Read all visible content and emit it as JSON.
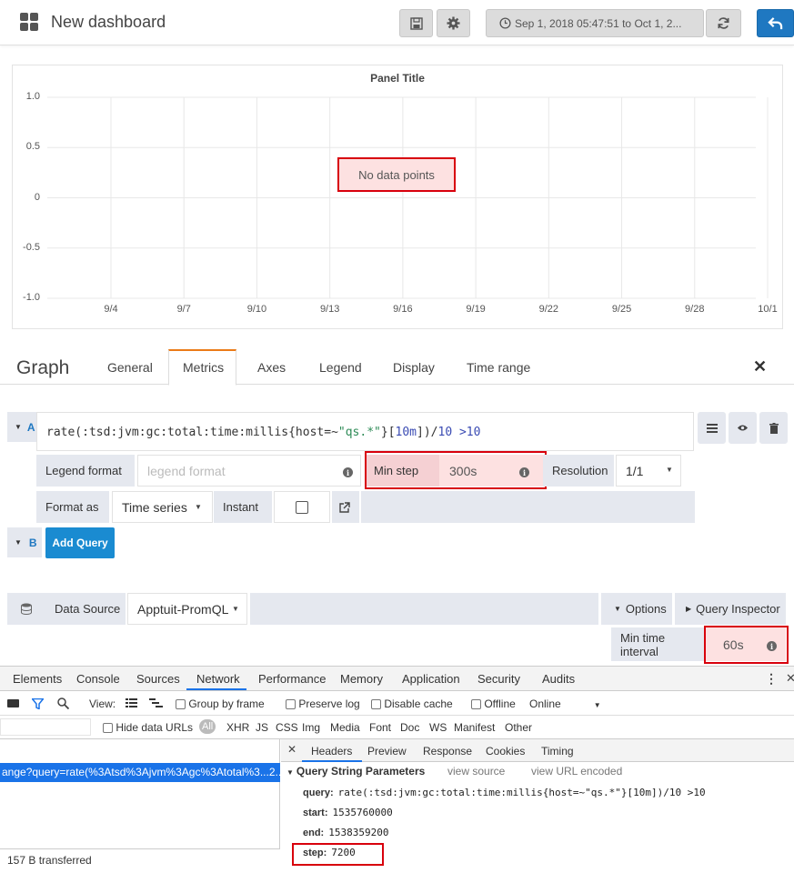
{
  "header": {
    "title": "New dashboard",
    "time_range": "Sep 1, 2018 05:47:51 to Oct 1, 2..."
  },
  "panel": {
    "title": "Panel Title",
    "no_data": "No data points",
    "y_ticks": [
      "1.0",
      "0.5",
      "0",
      "-0.5",
      "-1.0"
    ],
    "x_ticks": [
      "9/4",
      "9/7",
      "9/10",
      "9/13",
      "9/16",
      "9/19",
      "9/22",
      "9/25",
      "9/28",
      "10/1"
    ]
  },
  "editor": {
    "title": "Graph",
    "tabs": [
      "General",
      "Metrics",
      "Axes",
      "Legend",
      "Display",
      "Time range"
    ],
    "active_tab": "Metrics"
  },
  "query_a": {
    "letter": "A",
    "expr_pre": "rate(:tsd:jvm:gc:total:time:millis{host=~",
    "expr_str": "\"qs.*\"",
    "expr_mid": "}[",
    "expr_dur": "10m",
    "expr_close": "])/",
    "expr_num": "10",
    "expr_post": " >10",
    "legend_format_label": "Legend format",
    "legend_format_placeholder": "legend format",
    "min_step_label": "Min step",
    "min_step_value": "300s",
    "resolution_label": "Resolution",
    "resolution_value": "1/1",
    "format_as_label": "Format as",
    "format_as_value": "Time series",
    "instant_label": "Instant"
  },
  "query_b": {
    "letter": "B",
    "add_query": "Add Query"
  },
  "datasource": {
    "label": "Data Source",
    "value": "Apptuit-PromQL",
    "options": "Options",
    "query_inspector": "Query Inspector",
    "min_time_interval_label": "Min time interval",
    "min_time_interval_value": "60s"
  },
  "devtools": {
    "main_tabs": [
      "Elements",
      "Console",
      "Sources",
      "Network",
      "Performance",
      "Memory",
      "Application",
      "Security",
      "Audits"
    ],
    "active_main_tab": "Network",
    "toolbar": {
      "view_label": "View:",
      "group_by_frame": "Group by frame",
      "preserve_log": "Preserve log",
      "disable_cache": "Disable cache",
      "offline": "Offline",
      "online": "Online"
    },
    "filter": {
      "hide_data_urls": "Hide data URLs",
      "types": [
        "All",
        "XHR",
        "JS",
        "CSS",
        "Img",
        "Media",
        "Font",
        "Doc",
        "WS",
        "Manifest",
        "Other"
      ]
    },
    "request_url": "ange?query=rate(%3Atsd%3Ajvm%3Agc%3Atotal%3...2...",
    "transferred": "157 B transferred",
    "detail_tabs": [
      "Headers",
      "Preview",
      "Response",
      "Cookies",
      "Timing"
    ],
    "section_title": "Query String Parameters",
    "view_source": "view source",
    "view_url_encoded": "view URL encoded",
    "params": [
      {
        "key": "query:",
        "value": "rate(:tsd:jvm:gc:total:time:millis{host=~\"qs.*\"}[10m])/10 >10"
      },
      {
        "key": "start:",
        "value": "1535760000"
      },
      {
        "key": "end:",
        "value": "1538359200"
      },
      {
        "key": "step:",
        "value": "7200"
      }
    ]
  },
  "colors": {
    "accent": "#1f78c1",
    "highlight_red": "#d8000c",
    "add_query_bg": "#1a8bd1",
    "orange_tab": "#eb7b18"
  }
}
